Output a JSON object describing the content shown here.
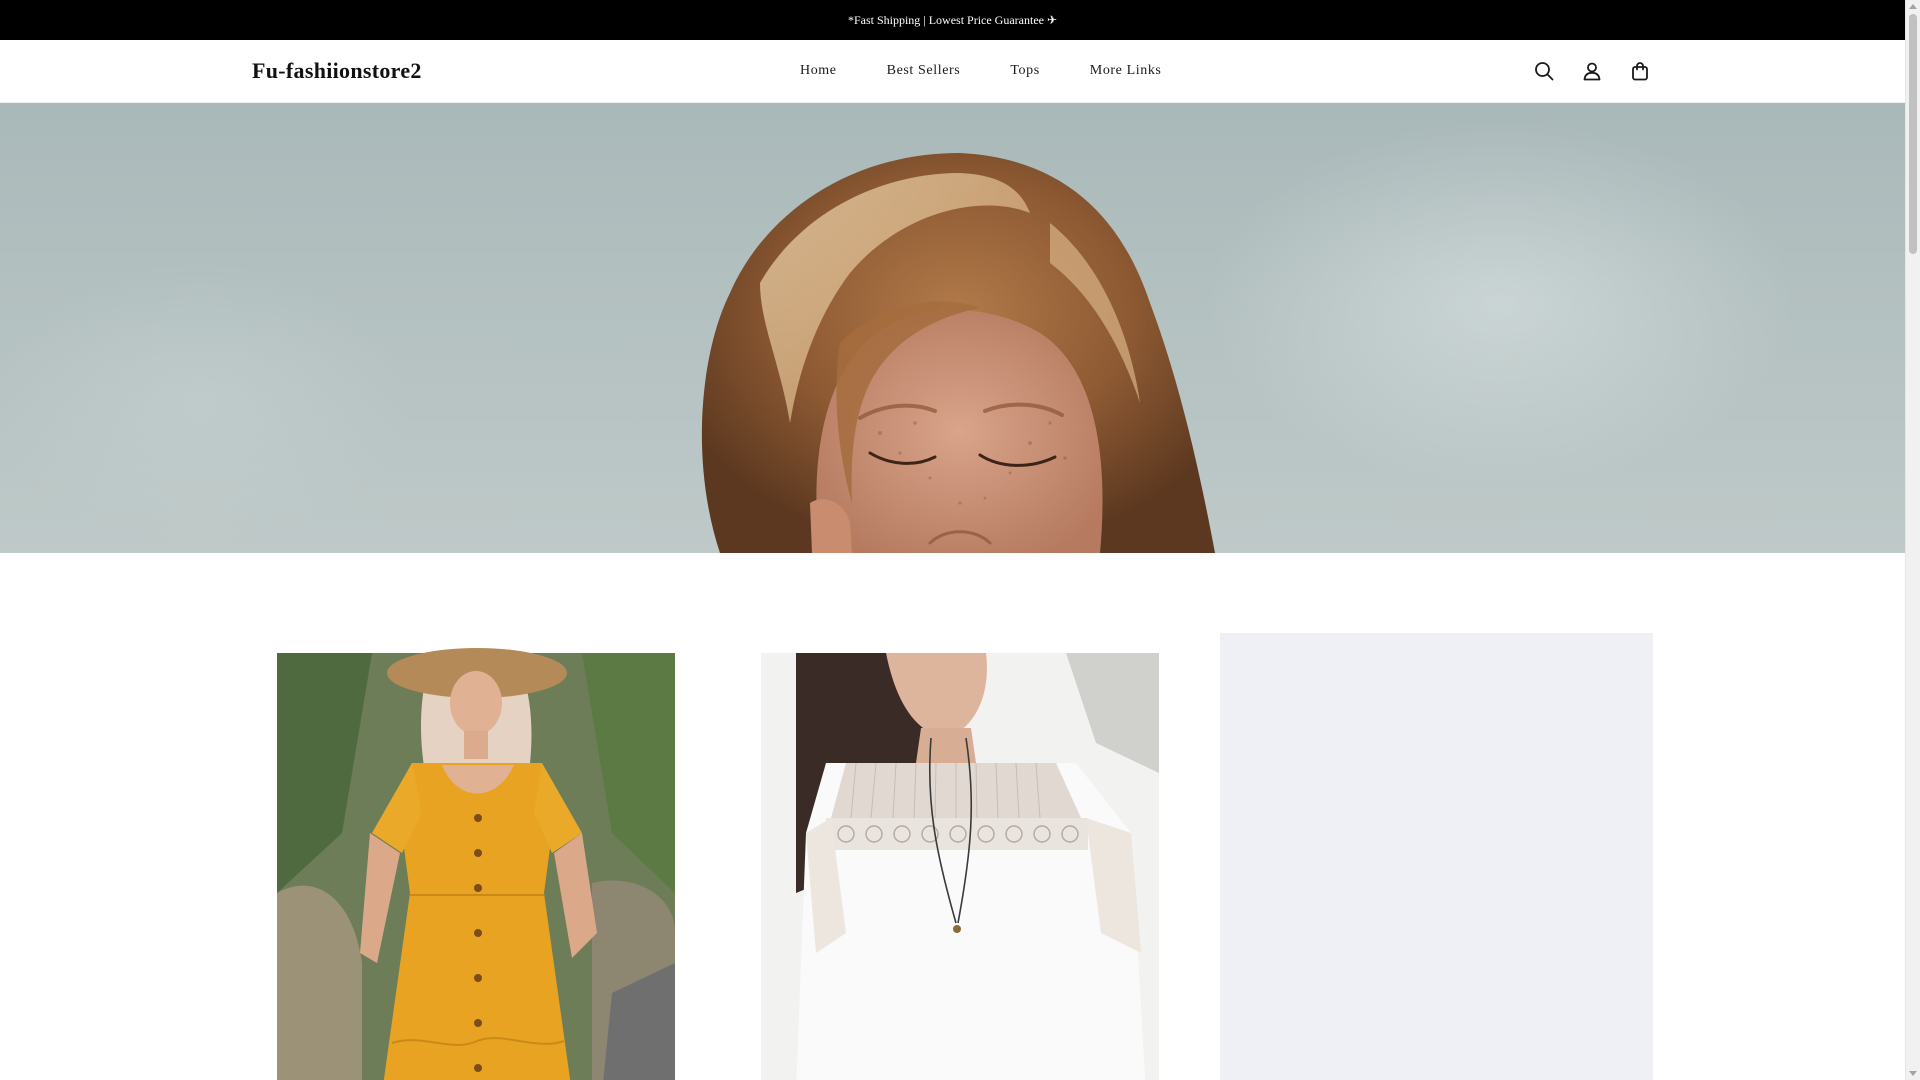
{
  "announcement": {
    "text": "*Fast Shipping | Lowest Price Guarantee ✈"
  },
  "header": {
    "logo": "Fu-fashiionstore2",
    "nav": [
      {
        "label": "Home"
      },
      {
        "label": "Best Sellers"
      },
      {
        "label": "Tops"
      },
      {
        "label": "More Links"
      }
    ],
    "icons": [
      "search-icon",
      "account-icon",
      "cart-icon"
    ]
  },
  "colors": {
    "announcement_bg": "#000000",
    "placeholder_bg": "#eff0f5",
    "hero_sky": "#b3c0c0"
  }
}
